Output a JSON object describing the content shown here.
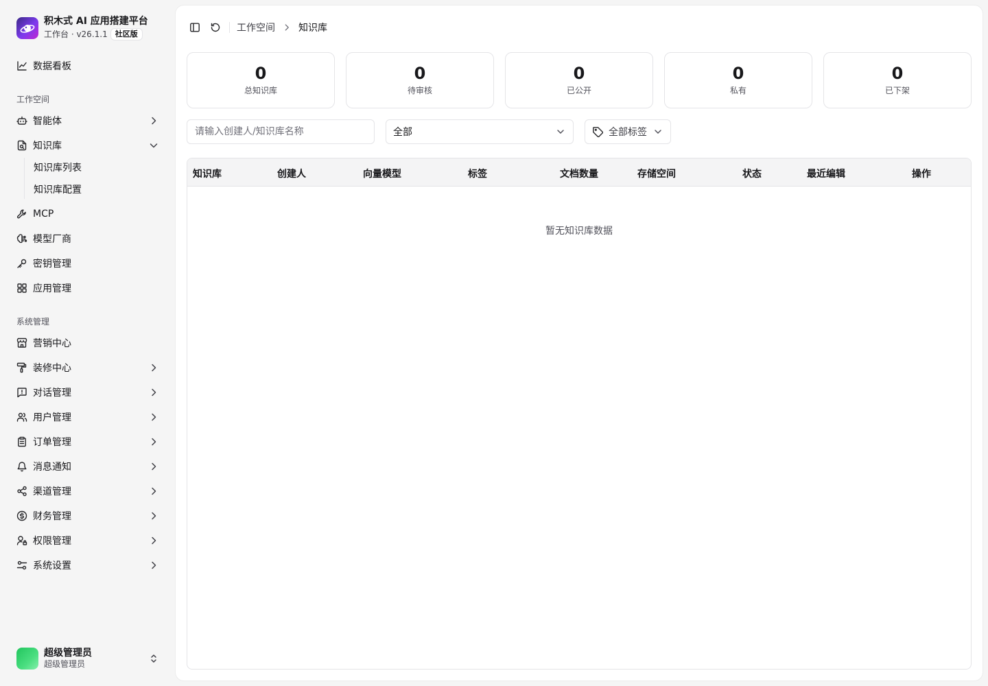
{
  "brand": {
    "title": "积木式 AI 应用搭建平台",
    "subtitle": "工作台 · v26.1.1",
    "edition": "社区版"
  },
  "sidebar": {
    "dashboard": "数据看板",
    "workspace_label": "工作空间",
    "agents": "智能体",
    "knowledge": "知识库",
    "knowledge_list": "知识库列表",
    "knowledge_config": "知识库配置",
    "mcp": "MCP",
    "model_vendor": "模型厂商",
    "key_management": "密钥管理",
    "app_management": "应用管理",
    "system_label": "系统管理",
    "marketing": "营销中心",
    "decoration": "装修中心",
    "conversation": "对话管理",
    "users": "用户管理",
    "orders": "订单管理",
    "notifications": "消息通知",
    "channels": "渠道管理",
    "finance": "财务管理",
    "permissions": "权限管理",
    "settings": "系统设置"
  },
  "user": {
    "name": "超级管理员",
    "role": "超级管理员"
  },
  "breadcrumb": {
    "workspace": "工作空间",
    "current": "知识库"
  },
  "stats": [
    {
      "value": "0",
      "label": "总知识库"
    },
    {
      "value": "0",
      "label": "待审核"
    },
    {
      "value": "0",
      "label": "已公开"
    },
    {
      "value": "0",
      "label": "私有"
    },
    {
      "value": "0",
      "label": "已下架"
    }
  ],
  "filters": {
    "search_placeholder": "请输入创建人/知识库名称",
    "search_value": "",
    "status_selected": "全部",
    "tag_selected": "全部标签"
  },
  "table": {
    "columns": [
      "知识库",
      "创建人",
      "向量模型",
      "标签",
      "文档数量",
      "存储空间",
      "状态",
      "最近编辑",
      "操作"
    ],
    "empty_text": "暂无知识库数据"
  }
}
